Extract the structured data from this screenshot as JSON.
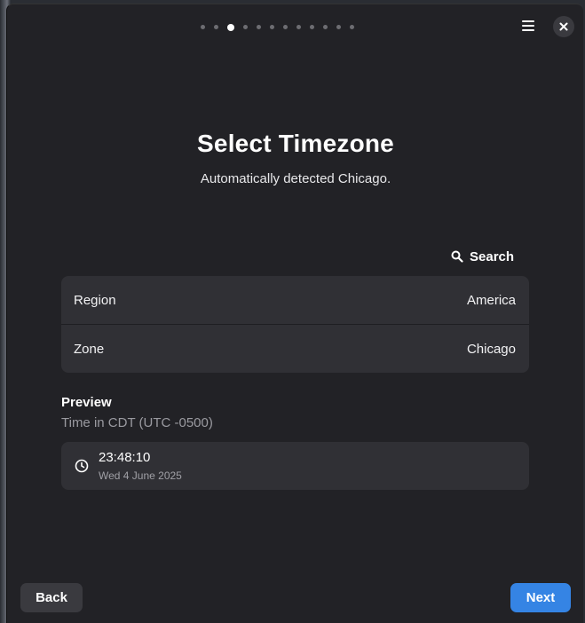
{
  "header": {
    "page_indicator": {
      "total": 12,
      "current": 3
    },
    "menu_icon": "hamburger-menu-icon",
    "close_icon": "close-icon"
  },
  "main": {
    "title": "Select Timezone",
    "subtitle": "Automatically detected Chicago.",
    "search": {
      "icon": "search-icon",
      "label": "Search"
    },
    "rows": [
      {
        "label": "Region",
        "value": "America"
      },
      {
        "label": "Zone",
        "value": "Chicago"
      }
    ],
    "preview": {
      "heading": "Preview",
      "subheading": "Time in CDT (UTC -0500)",
      "time": "23:48:10",
      "date": "Wed 4 June 2025",
      "icon": "clock-icon"
    }
  },
  "footer": {
    "back_label": "Back",
    "next_label": "Next"
  },
  "colors": {
    "background": "#222226",
    "card": "#303035",
    "accent": "#3584e4"
  }
}
